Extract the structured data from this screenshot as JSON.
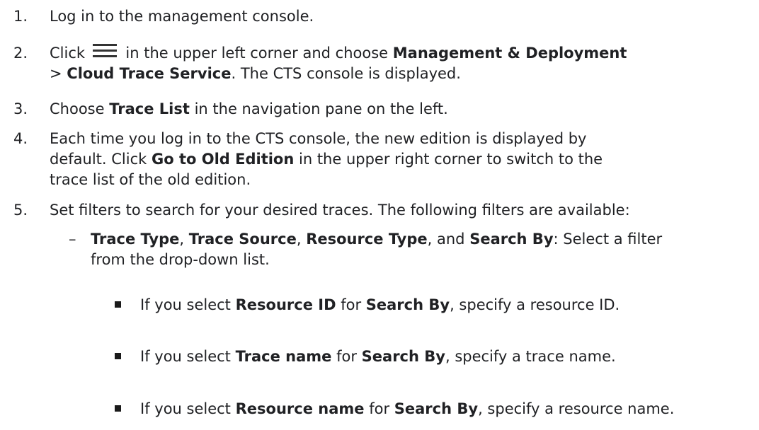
{
  "steps": [
    {
      "num": "1.",
      "text": "Log in to the management console."
    },
    {
      "num": "2.",
      "t1": "Click",
      "t2": "in the upper left corner and choose",
      "b1": "Management & Deployment",
      "t3": ">",
      "b2": "Cloud Trace Service",
      "t4": ". The CTS console is displayed."
    },
    {
      "num": "3.",
      "t1": "Choose",
      "b1": "Trace List",
      "t2": "in the navigation pane on the left."
    },
    {
      "num": "4.",
      "l1": "Each time you log in to the CTS console, the new edition is displayed by",
      "t1": "default. Click",
      "b1": "Go to Old Edition",
      "t2": "in the upper right corner to switch to the",
      "l3": "trace list of the old edition."
    },
    {
      "num": "5.",
      "text": "Set filters to search for your desired traces. The following filters are available:"
    }
  ],
  "filter": {
    "dash": "–",
    "b1": "Trace Type",
    "s1": ",",
    "b2": "Trace Source",
    "s2": ",",
    "b3": "Resource Type",
    "s3": ", and",
    "b4": "Search By",
    "s4": ": Select a filter",
    "l2": "from the drop-down list."
  },
  "bullets": [
    {
      "t1": "If you select",
      "b1": "Resource ID",
      "t2": "for",
      "b2": "Search By",
      "t3": ", specify a resource ID."
    },
    {
      "t1": "If you select",
      "b1": "Trace name",
      "t2": "for",
      "b2": "Search By",
      "t3": ", specify a trace name."
    },
    {
      "t1": "If you select",
      "b1": "Resource name",
      "t2": "for",
      "b2": "Search By",
      "t3": ", specify a resource name."
    }
  ]
}
